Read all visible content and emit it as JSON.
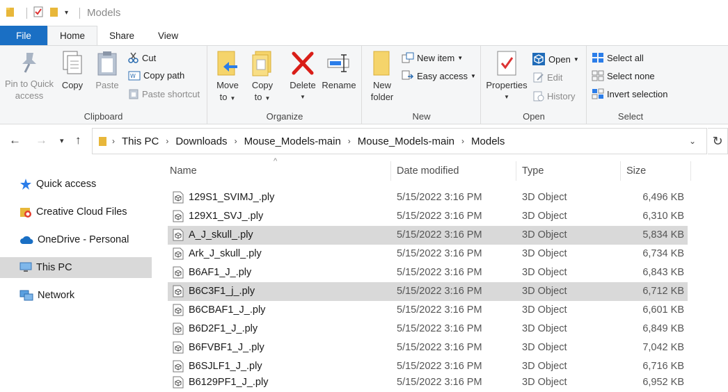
{
  "window": {
    "title": "Models"
  },
  "tabs": [
    {
      "label": "File"
    },
    {
      "label": "Home"
    },
    {
      "label": "Share"
    },
    {
      "label": "View"
    }
  ],
  "ribbon": {
    "clipboard": {
      "label": "Clipboard",
      "pin_label_1": "Pin to Quick",
      "pin_label_2": "access",
      "copy_label": "Copy",
      "paste_label": "Paste",
      "cut_label": "Cut",
      "copy_path_label": "Copy path",
      "paste_shortcut_label": "Paste shortcut"
    },
    "organize": {
      "label": "Organize",
      "move_to_1": "Move",
      "move_to_2": "to",
      "copy_to_1": "Copy",
      "copy_to_2": "to",
      "delete_label": "Delete",
      "rename_label": "Rename"
    },
    "new": {
      "label": "New",
      "new_folder_1": "New",
      "new_folder_2": "folder",
      "new_item_label": "New item",
      "easy_access_label": "Easy access"
    },
    "open": {
      "label": "Open",
      "properties_label": "Properties",
      "open_label": "Open",
      "edit_label": "Edit",
      "history_label": "History"
    },
    "select": {
      "label": "Select",
      "select_all_label": "Select all",
      "select_none_label": "Select none",
      "invert_selection_label": "Invert selection"
    }
  },
  "breadcrumb": [
    "This PC",
    "Downloads",
    "Mouse_Models-main",
    "Mouse_Models-main",
    "Models"
  ],
  "sidebar": {
    "items": [
      {
        "label": "Quick access"
      },
      {
        "label": "Creative Cloud Files"
      },
      {
        "label": "OneDrive - Personal"
      },
      {
        "label": "This PC"
      },
      {
        "label": "Network"
      }
    ]
  },
  "columns": {
    "name": "Name",
    "date": "Date modified",
    "type": "Type",
    "size": "Size"
  },
  "files": [
    {
      "name": "129S1_SVIMJ_.ply",
      "date": "5/15/2022 3:16 PM",
      "type": "3D Object",
      "size": "6,496 KB"
    },
    {
      "name": "129X1_SVJ_.ply",
      "date": "5/15/2022 3:16 PM",
      "type": "3D Object",
      "size": "6,310 KB"
    },
    {
      "name": "A_J_skull_.ply",
      "date": "5/15/2022 3:16 PM",
      "type": "3D Object",
      "size": "5,834 KB"
    },
    {
      "name": "Ark_J_skull_.ply",
      "date": "5/15/2022 3:16 PM",
      "type": "3D Object",
      "size": "6,734 KB"
    },
    {
      "name": "B6AF1_J_.ply",
      "date": "5/15/2022 3:16 PM",
      "type": "3D Object",
      "size": "6,843 KB"
    },
    {
      "name": "B6C3F1_j_.ply",
      "date": "5/15/2022 3:16 PM",
      "type": "3D Object",
      "size": "6,712 KB"
    },
    {
      "name": "B6CBAF1_J_.ply",
      "date": "5/15/2022 3:16 PM",
      "type": "3D Object",
      "size": "6,601 KB"
    },
    {
      "name": "B6D2F1_J_.ply",
      "date": "5/15/2022 3:16 PM",
      "type": "3D Object",
      "size": "6,849 KB"
    },
    {
      "name": "B6FVBF1_J_.ply",
      "date": "5/15/2022 3:16 PM",
      "type": "3D Object",
      "size": "7,042 KB"
    },
    {
      "name": "B6SJLF1_J_.ply",
      "date": "5/15/2022 3:16 PM",
      "type": "3D Object",
      "size": "6,716 KB"
    },
    {
      "name": "B6129PF1_J_.ply",
      "date": "5/15/2022 3:16 PM",
      "type": "3D Object",
      "size": "6,952 KB"
    }
  ],
  "colors": {
    "accent": "#1a6fc4",
    "selection": "#d9d9d9"
  }
}
